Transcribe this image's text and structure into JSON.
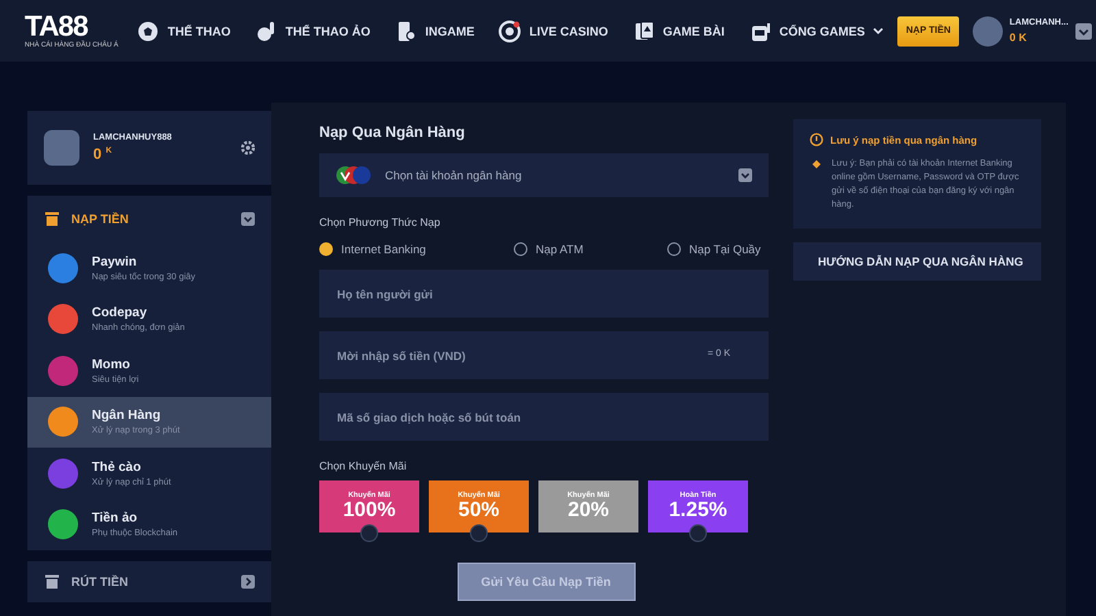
{
  "header": {
    "logo": "TA88",
    "logo_tagline": "NHÀ CÁI HÀNG ĐẦU CHÂU Á",
    "nav": [
      {
        "label": "THỂ THAO",
        "dropdown": false
      },
      {
        "label": "THỂ THAO ẢO",
        "dropdown": false
      },
      {
        "label": "INGAME",
        "dropdown": false
      },
      {
        "label": "LIVE CASINO",
        "dropdown": false
      },
      {
        "label": "GAME BÀI",
        "dropdown": false
      },
      {
        "label": "CỔNG GAMES",
        "dropdown": true
      }
    ],
    "deposit_button": "NẠP TIỀN",
    "user": {
      "name": "LAMCHANH...",
      "balance": "0 K"
    }
  },
  "sidebar": {
    "profile": {
      "name": "LAMCHANHUY888",
      "balance": "0",
      "unit": "K"
    },
    "sections": [
      {
        "title": "NẠP TIỀN",
        "expanded": true,
        "items": [
          {
            "title": "Paywin",
            "subtitle": "Nạp siêu tốc trong 30 giây",
            "color": "#2b7fe0",
            "selected": false
          },
          {
            "title": "Codepay",
            "subtitle": "Nhanh chóng, đơn giản",
            "color": "#e8483a",
            "selected": false
          },
          {
            "title": "Momo",
            "subtitle": "Siêu tiện lợi",
            "color": "#c2287a",
            "selected": false
          },
          {
            "title": "Ngân Hàng",
            "subtitle": "Xử lý nạp trong 3 phút",
            "color": "#f08a1c",
            "selected": true
          },
          {
            "title": "Thẻ cào",
            "subtitle": "Xử lý nạp chỉ 1 phút",
            "color": "#7b3fe0",
            "selected": false
          },
          {
            "title": "Tiền ảo",
            "subtitle": "Phụ thuộc Blockchain",
            "color": "#22b34a",
            "selected": false
          }
        ]
      },
      {
        "title": "RÚT TIỀN",
        "expanded": false
      }
    ]
  },
  "form": {
    "title": "Nạp Qua Ngân Hàng",
    "bank_select": {
      "placeholder": "Chọn tài khoản ngân hàng"
    },
    "method_label": "Chọn Phương Thức Nạp",
    "methods": [
      {
        "label": "Internet Banking",
        "selected": true
      },
      {
        "label": "Nạp ATM",
        "selected": false
      },
      {
        "label": "Nạp Tại Quầy",
        "selected": false
      }
    ],
    "fields": [
      {
        "placeholder": "Họ tên người gửi"
      },
      {
        "placeholder": "Mời nhập số tiền (VND)",
        "suffix": "= 0 K"
      },
      {
        "placeholder": "Mã số giao dịch hoặc số bút toán"
      }
    ],
    "promo_label": "Chọn Khuyến Mãi",
    "promos": [
      {
        "caption": "Khuyến Mãi",
        "value": "100%",
        "color": "#d63a78",
        "disabled": false,
        "selected": false
      },
      {
        "caption": "Khuyến Mãi",
        "value": "50%",
        "color": "#e8721c",
        "disabled": false,
        "selected": false
      },
      {
        "caption": "Khuyến Mãi",
        "value": "20%",
        "color": "#9a9a9a",
        "disabled": true
      },
      {
        "caption": "Hoàn Tiền",
        "value": "1.25%",
        "color": "#8a3ff0",
        "disabled": false,
        "selected": false
      }
    ],
    "submit": {
      "label": "Gửi Yêu Cầu Nạp Tiền",
      "disabled": true
    }
  },
  "notice": {
    "title": "Lưu ý nạp tiền qua ngân hàng",
    "text": "Lưu ý: Bạn phải có tài khoản Internet Banking online gồm Username, Password và OTP được gửi về số điện thoại của bạn đăng ký với ngân hàng."
  },
  "guide_button": "HƯỚNG DẪN NẠP QUA NGÂN HÀNG"
}
